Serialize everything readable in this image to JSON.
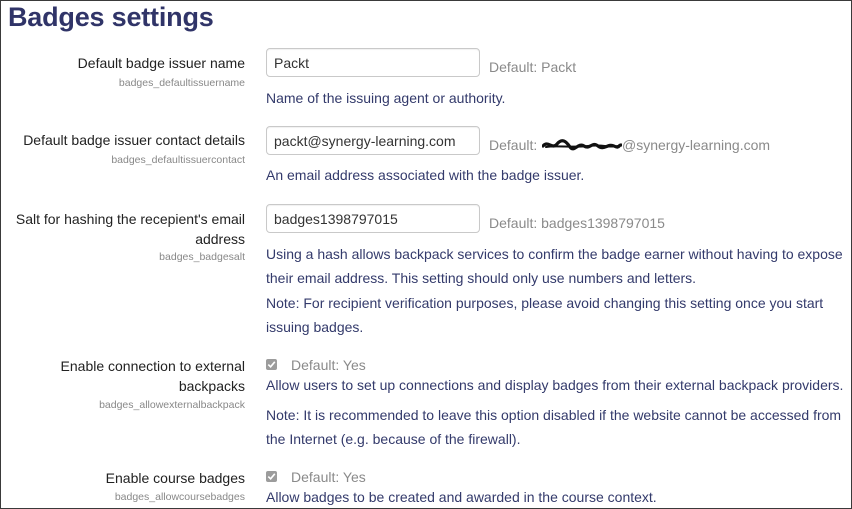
{
  "page": {
    "title": "Badges settings"
  },
  "settings": [
    {
      "label": "Default badge issuer name",
      "key": "badges_defaultissuername",
      "value": "Packt",
      "default": "Default: Packt",
      "description": "Name of the issuing agent or authority."
    },
    {
      "label": "Default badge issuer contact details",
      "key": "badges_defaultissuercontact",
      "value": "packt@synergy-learning.com",
      "default_prefix": "Default:",
      "default_suffix": "@synergy-learning.com",
      "description": "An email address associated with the badge issuer."
    },
    {
      "label_line1": "Salt for hashing the recepient's email",
      "label_line2": "address",
      "key": "badges_badgesalt",
      "value": "badges1398797015",
      "default": "Default: badges1398797015",
      "description": "Using a hash allows backpack services to confirm the badge earner without having to expose their email address. This setting should only use numbers and letters.",
      "note": "Note: For recipient verification purposes, please avoid changing this setting once you start issuing badges."
    },
    {
      "label_line1": "Enable connection to external",
      "label_line2": "backpacks",
      "key": "badges_allowexternalbackpack",
      "default": "Default: Yes",
      "description": "Allow users to set up connections and display badges from their external backpack providers.",
      "note": "Note: It is recommended to leave this option disabled if the website cannot be accessed from the Internet (e.g. because of the firewall)."
    },
    {
      "label": "Enable course badges",
      "key": "badges_allowcoursebadges",
      "default": "Default: Yes",
      "description": "Allow badges to be created and awarded in the course context."
    }
  ]
}
